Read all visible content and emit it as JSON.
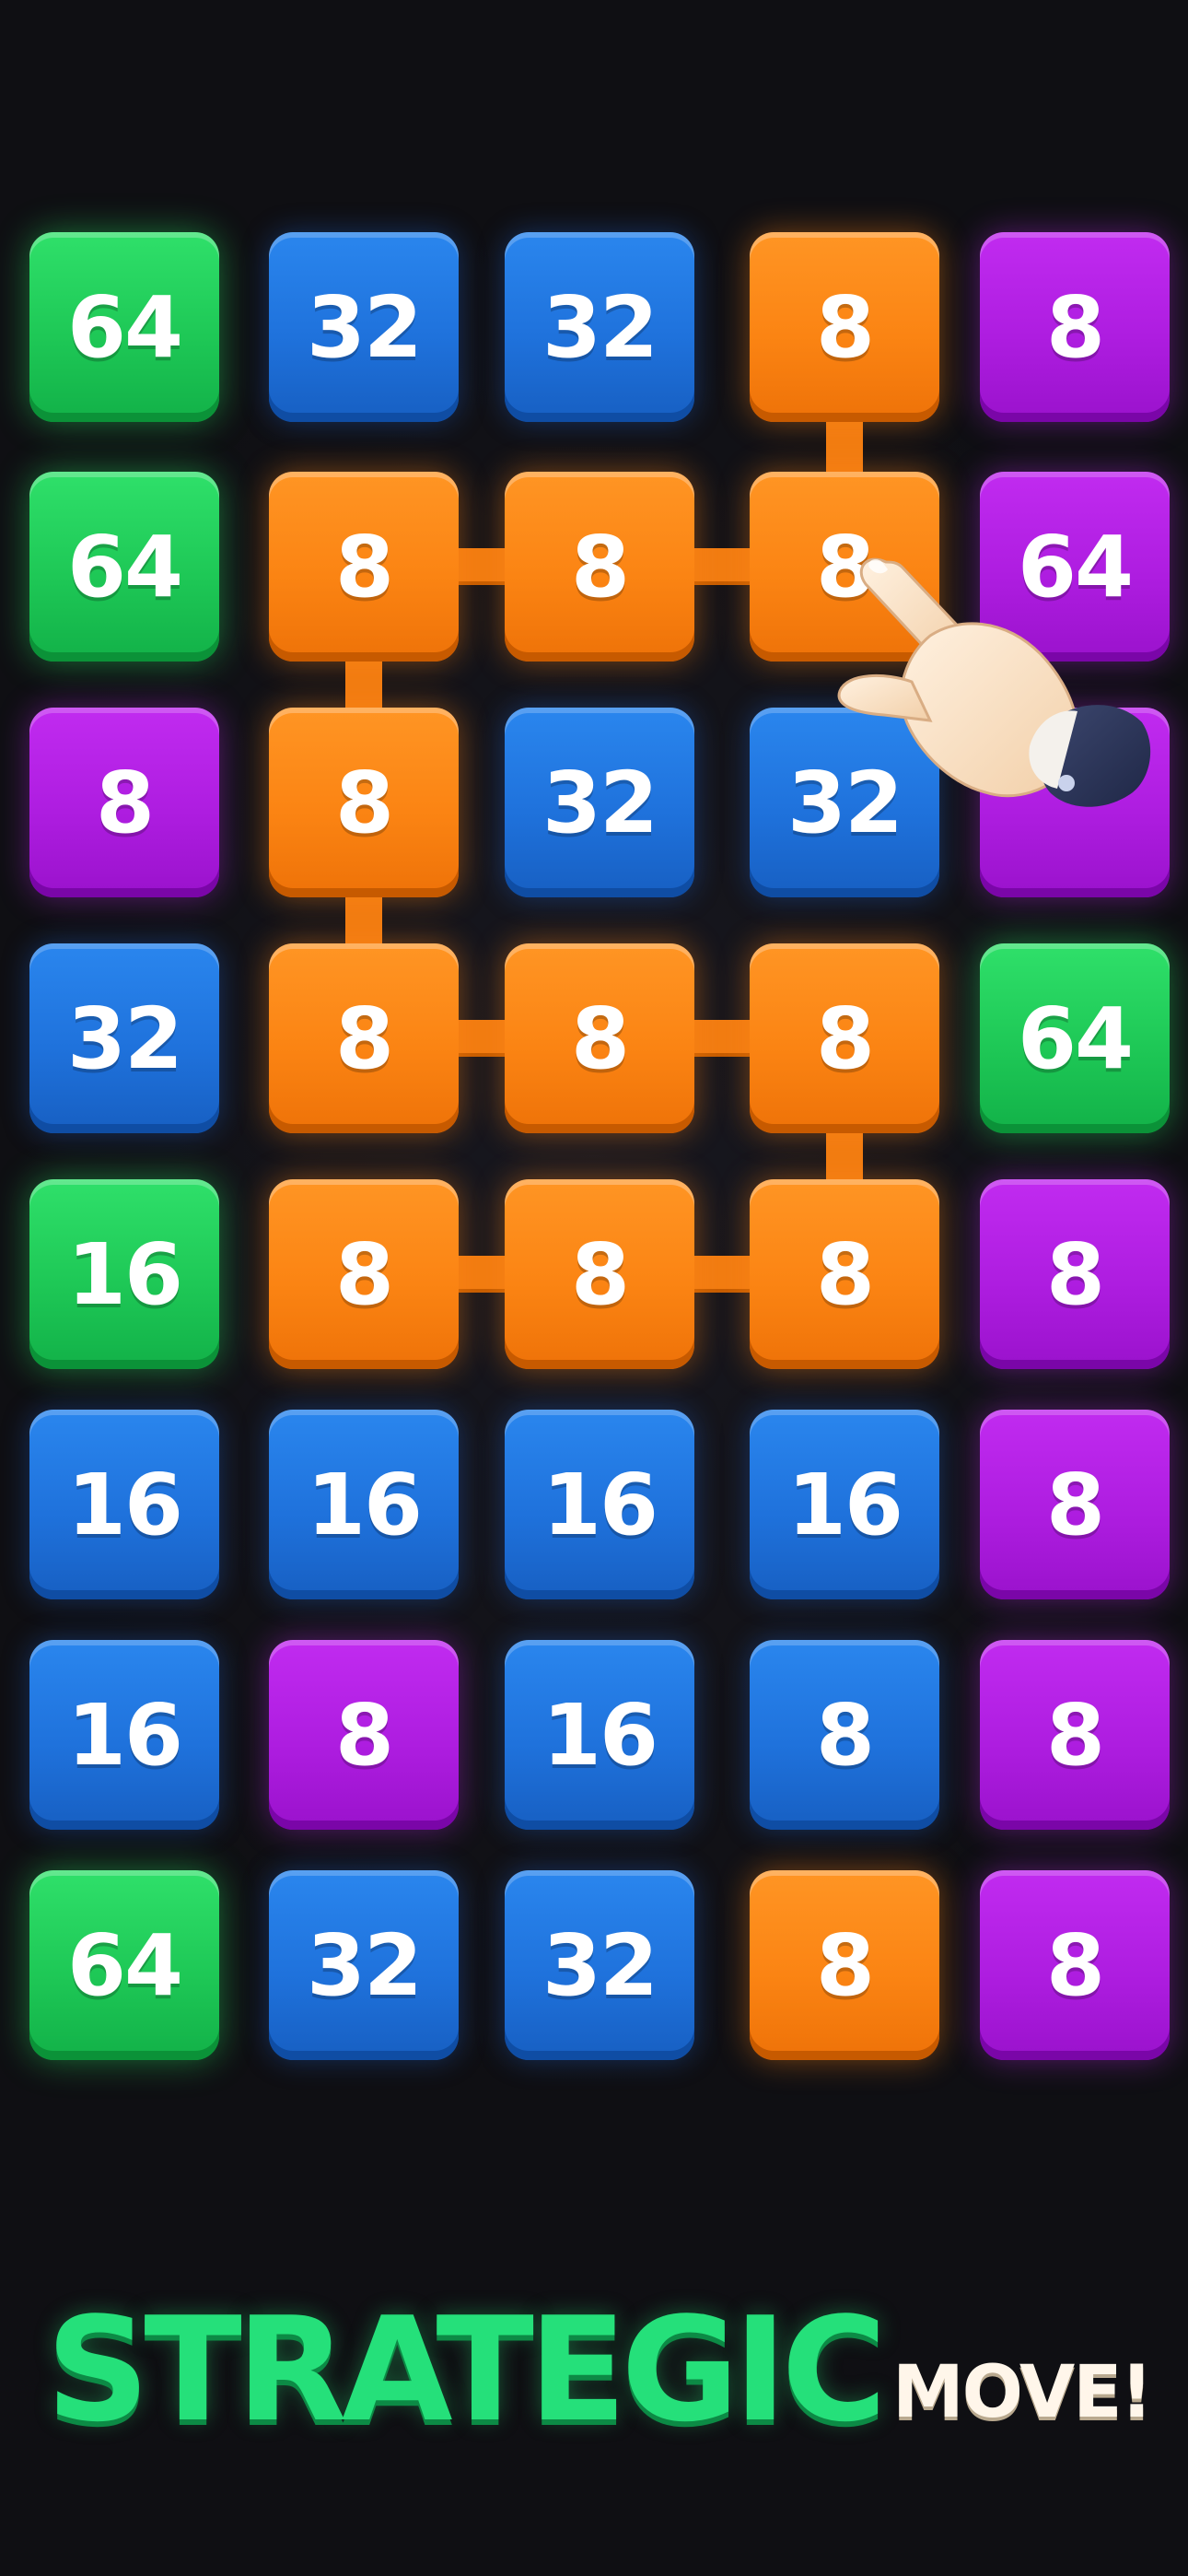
{
  "board": {
    "rows": [
      [
        {
          "value": "64",
          "color": "green"
        },
        {
          "value": "32",
          "color": "blue"
        },
        {
          "value": "32",
          "color": "blue"
        },
        {
          "value": "8",
          "color": "orange"
        },
        {
          "value": "8",
          "color": "purple"
        }
      ],
      [
        {
          "value": "64",
          "color": "green"
        },
        {
          "value": "8",
          "color": "orange"
        },
        {
          "value": "8",
          "color": "orange"
        },
        {
          "value": "8",
          "color": "orange"
        },
        {
          "value": "64",
          "color": "purple"
        }
      ],
      [
        {
          "value": "8",
          "color": "purple"
        },
        {
          "value": "8",
          "color": "orange"
        },
        {
          "value": "32",
          "color": "blue"
        },
        {
          "value": "32",
          "color": "blue"
        },
        {
          "value": "",
          "color": "purple"
        }
      ],
      [
        {
          "value": "32",
          "color": "blue"
        },
        {
          "value": "8",
          "color": "orange"
        },
        {
          "value": "8",
          "color": "orange"
        },
        {
          "value": "8",
          "color": "orange"
        },
        {
          "value": "64",
          "color": "green"
        }
      ],
      [
        {
          "value": "16",
          "color": "green"
        },
        {
          "value": "8",
          "color": "orange"
        },
        {
          "value": "8",
          "color": "orange"
        },
        {
          "value": "8",
          "color": "orange"
        },
        {
          "value": "8",
          "color": "purple"
        }
      ],
      [
        {
          "value": "16",
          "color": "blue"
        },
        {
          "value": "16",
          "color": "blue"
        },
        {
          "value": "16",
          "color": "blue"
        },
        {
          "value": "16",
          "color": "blue"
        },
        {
          "value": "8",
          "color": "purple"
        }
      ],
      [
        {
          "value": "16",
          "color": "blue"
        },
        {
          "value": "8",
          "color": "purple"
        },
        {
          "value": "16",
          "color": "blue"
        },
        {
          "value": "8",
          "color": "blue"
        },
        {
          "value": "8",
          "color": "purple"
        }
      ],
      [
        {
          "value": "64",
          "color": "green"
        },
        {
          "value": "32",
          "color": "blue"
        },
        {
          "value": "32",
          "color": "blue"
        },
        {
          "value": "8",
          "color": "orange"
        },
        {
          "value": "8",
          "color": "purple"
        }
      ]
    ],
    "chain": [
      [
        0,
        3
      ],
      [
        1,
        3
      ],
      [
        1,
        2
      ],
      [
        1,
        1
      ],
      [
        2,
        1
      ],
      [
        3,
        1
      ],
      [
        3,
        2
      ],
      [
        3,
        3
      ],
      [
        4,
        3
      ],
      [
        4,
        2
      ],
      [
        4,
        1
      ]
    ],
    "colors": {
      "green": "#1ec856",
      "blue": "#1f72dc",
      "orange": "#fb8413",
      "purple": "#ae1de0"
    },
    "pointer": "pointing-hand-icon"
  },
  "slogan": {
    "main": "STRATEGIC",
    "sub": "MOVE!"
  }
}
